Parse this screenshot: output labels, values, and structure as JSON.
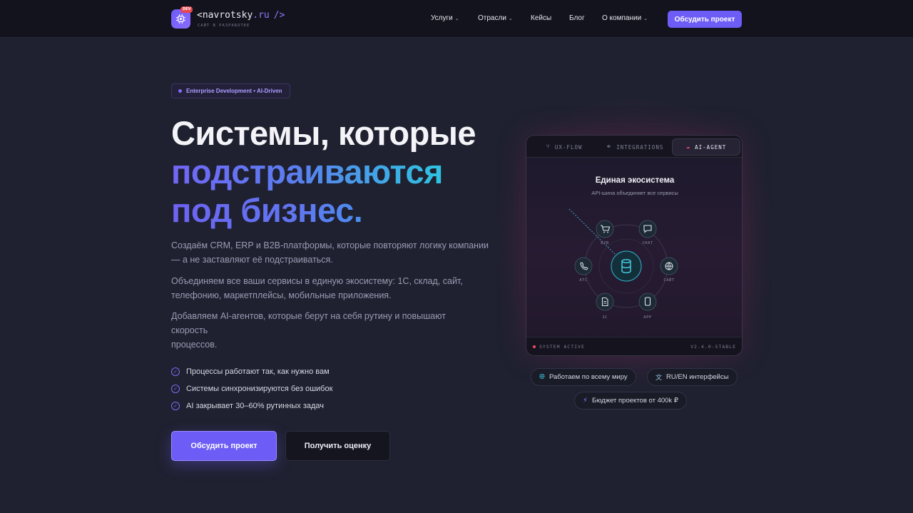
{
  "header": {
    "logo_badge": "DEV",
    "logo_name": "<navrotsky",
    "logo_tld": ".ru",
    "logo_tag": "/>",
    "logo_sub": "САЙТ В РАЗРАБОТКЕ",
    "nav": [
      {
        "label": "Услуги",
        "dropdown": true
      },
      {
        "label": "Отрасли",
        "dropdown": true
      },
      {
        "label": "Кейсы",
        "dropdown": false
      },
      {
        "label": "Блог",
        "dropdown": false
      },
      {
        "label": "О компании",
        "dropdown": true
      }
    ],
    "cta": "Обсудить проект"
  },
  "hero": {
    "badge": "Enterprise Development • AI-Driven",
    "title_line1": "Системы, которые",
    "title_line2": "подстраиваются",
    "title_line3": "под бизнес.",
    "p1": "Создаём CRM, ERP и B2B-платформы, которые повторяют логику компании — а не заставляют её подстраиваться.",
    "p2": "Объединяем все ваши сервисы в единую экосистему: 1С, склад, сайт, телефонию, маркетплейсы, мобильные приложения.",
    "p3_line1": "Добавляем AI-агентов, которые берут на себя рутину и повышают",
    "p3_line2": "скорость",
    "p3_line3": "процессов.",
    "checks": [
      "Процессы работают так, как нужно вам",
      "Системы синхронизируются без ошибок",
      "AI закрывает 30–60% рутинных задач"
    ],
    "btn_primary": "Обсудить проект",
    "btn_secondary": "Получить оценку"
  },
  "panel": {
    "tabs": [
      {
        "label": "UX-FLOW",
        "icon": "branch-icon"
      },
      {
        "label": "INTEGRATIONS",
        "icon": "link-icon"
      },
      {
        "label": "AI-AGENT",
        "icon": "cloud-icon",
        "active": true
      }
    ],
    "title": "Единая экосистема",
    "subtitle": "API-шина объединяет все сервисы",
    "nodes": [
      "B2B",
      "CHAT",
      "САЙТ",
      "APP",
      "1С",
      "АТС"
    ],
    "center_icon": "database-icon",
    "status": "SYSTEM ACTIVE",
    "version": "V2.4.0-STABLE"
  },
  "chips": [
    {
      "label": "Работаем по всему миру",
      "icon": "globe-icon"
    },
    {
      "label": "RU/EN интерфейсы",
      "icon": "translate-icon"
    },
    {
      "label": "Бюджет проектов от 400k ₽",
      "icon": "lightning-icon"
    }
  ],
  "colors": {
    "accent": "#6d5cf5",
    "cyan": "#2ec4e0",
    "status": "#ef4a6a"
  }
}
